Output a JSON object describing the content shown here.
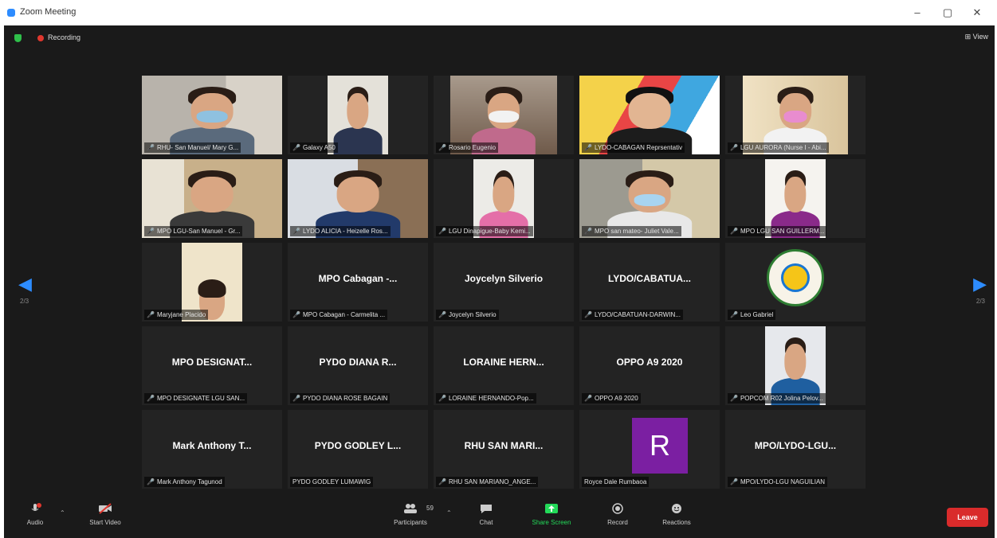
{
  "window": {
    "title": "Zoom Meeting",
    "minimize": "–",
    "restore": "▢",
    "close": "✕"
  },
  "meeting": {
    "recording_label": "Recording",
    "view_label": "⊞ View",
    "page_left": "2/3",
    "page_right": "2/3"
  },
  "tiles": [
    {
      "label": "RHU- San Manuel/ Mary G...",
      "video": true
    },
    {
      "label": "Galaxy A50",
      "video": true
    },
    {
      "label": "Rosario Eugenio",
      "video": true
    },
    {
      "label": "LYDO-CABAGAN Reprsentativ",
      "video": true
    },
    {
      "label": "LGU AURORA (Nurse I - Abi...",
      "video": true
    },
    {
      "label": "MPO LGU-San Manuel - Gr...",
      "video": true
    },
    {
      "label": "LYDO ALICIA - Heizelle Ros...",
      "video": true
    },
    {
      "label": "LGU Dinapigue-Baby Kemi...",
      "video": true
    },
    {
      "label": "MPO san mateo- Juliet Vale...",
      "video": true
    },
    {
      "label": "MPO LGU SAN GUILLERM...",
      "video": true
    },
    {
      "label": "Maryjane Placido",
      "video": true
    },
    {
      "label": "MPO Cabagan - Carmelita ...",
      "display": "MPO Cabagan -..."
    },
    {
      "label": "Joycelyn Silverio",
      "display": "Joycelyn Silverio"
    },
    {
      "label": "LYDO/CABATUAN-DARWIN...",
      "display": "LYDO/CABATUA..."
    },
    {
      "label": "Leo Gabriel",
      "logo": true
    },
    {
      "label": "MPO DESIGNATE LGU SAN...",
      "display": "MPO DESIGNAT..."
    },
    {
      "label": "PYDO DIANA ROSE BAGAIN",
      "display": "PYDO DIANA R..."
    },
    {
      "label": "LORAINE HERNANDO-Pop...",
      "display": "LORAINE HERN..."
    },
    {
      "label": "OPPO A9 2020",
      "display": "OPPO A9 2020"
    },
    {
      "label": "POPCOM R02 Jolina Pelov...",
      "video": true
    },
    {
      "label": "Mark Anthony Tagunod",
      "display": "Mark Anthony T..."
    },
    {
      "label": "PYDO GODLEY LUMAWIG",
      "display": "PYDO GODLEY L...",
      "unmuted": true
    },
    {
      "label": "RHU SAN MARIANO_ANGE...",
      "display": "RHU SAN MARI..."
    },
    {
      "label": "Royce Dale Rumbaoa",
      "avatar": "R",
      "unmuted": true
    },
    {
      "label": "MPO/LYDO-LGU NAGUILIAN",
      "display": "MPO/LYDO-LGU..."
    }
  ],
  "toolbar": {
    "audio": "Audio",
    "start_video": "Start Video",
    "participants": "Participants",
    "participant_count": "59",
    "chat": "Chat",
    "share_screen": "Share Screen",
    "record": "Record",
    "reactions": "Reactions",
    "leave": "Leave"
  },
  "colors": {
    "accent": "#2d8cff",
    "share_green": "#23d959",
    "leave_red": "#d92b2b",
    "muted_red": "#e0372e",
    "avatar_purple": "#7b1fa2"
  }
}
